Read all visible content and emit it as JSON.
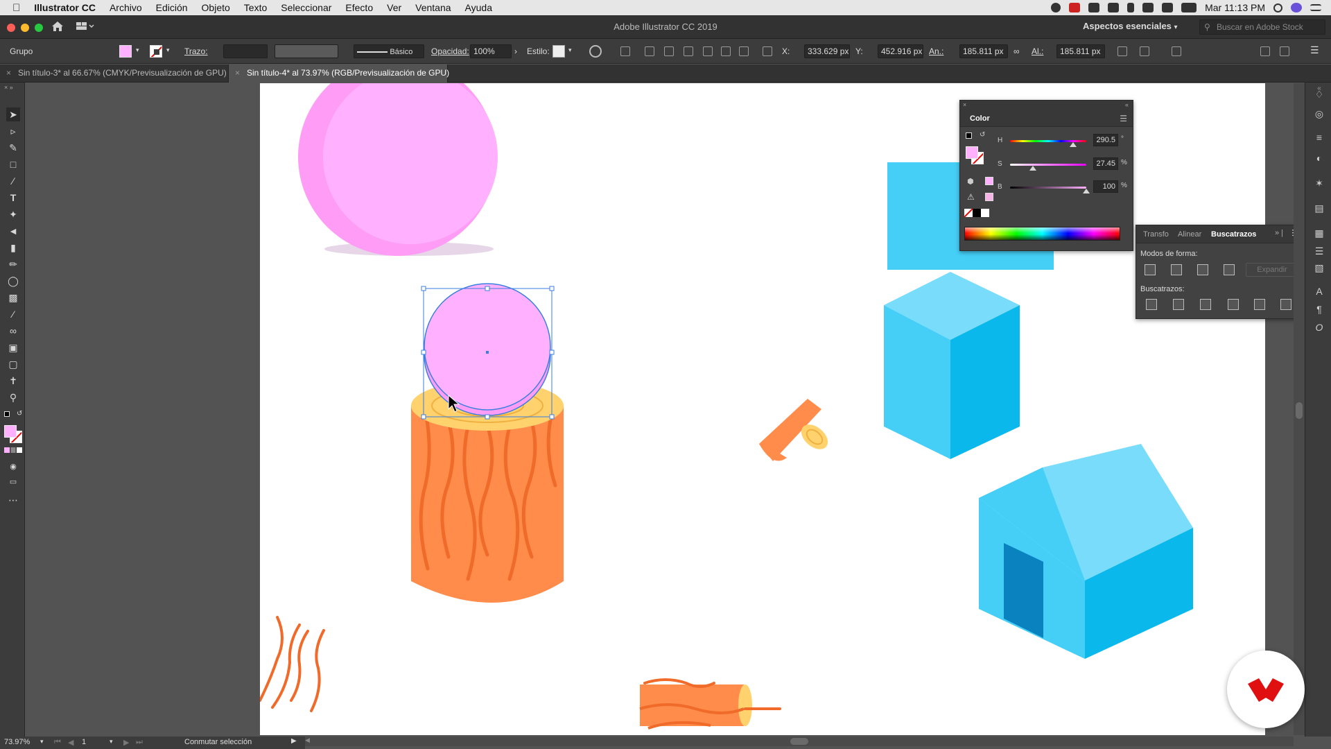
{
  "menubar": {
    "app_name": "Illustrator CC",
    "items": [
      "Archivo",
      "Edición",
      "Objeto",
      "Texto",
      "Seleccionar",
      "Efecto",
      "Ver",
      "Ventana",
      "Ayuda"
    ],
    "clock": "Mar 11:13 PM"
  },
  "window": {
    "title": "Adobe Illustrator CC 2019",
    "workspace": "Aspectos esenciales",
    "stock_placeholder": "Buscar en Adobe Stock"
  },
  "controlbar": {
    "selection_label": "Grupo",
    "stroke_label": "Trazo:",
    "brush_label": "Básico",
    "opacity_label": "Opacidad:",
    "opacity_value": "100%",
    "style_label": "Estilo:",
    "x_label": "X:",
    "x_value": "333.629 px",
    "y_label": "Y:",
    "y_value": "452.916 px",
    "w_label": "An.:",
    "w_value": "185.811 px",
    "h_label": "Al.:",
    "h_value": "185.811 px"
  },
  "tabs": [
    {
      "label": "Sin título-3* al 66.67% (CMYK/Previsualización de GPU)",
      "active": false
    },
    {
      "label": "Sin título-4* al 73.97% (RGB/Previsualización de GPU)",
      "active": true
    }
  ],
  "color_panel": {
    "title": "Color",
    "h_label": "H",
    "h_value": "290.5",
    "h_unit": "°",
    "s_label": "S",
    "s_value": "27.45",
    "s_unit": "%",
    "b_label": "B",
    "b_value": "100",
    "b_unit": "%",
    "fill_color": "#ffb1ff"
  },
  "pathfinder_panel": {
    "tabs": [
      "Transfo",
      "Alinear",
      "Buscatrazos"
    ],
    "active_tab": "Buscatrazos",
    "shape_modes_label": "Modos de forma:",
    "expand_label": "Expandir",
    "pathfinders_label": "Buscatrazos:"
  },
  "statusbar": {
    "zoom": "73.97%",
    "artboard_num": "1",
    "status_text": "Conmutar selección"
  },
  "colors": {
    "pink": "#ffb1ff",
    "pink_dark": "#ff9cf6",
    "orange": "#ff8c4a",
    "orange_line": "#f06a2a",
    "wood_top": "#ffd26e",
    "cyan": "#45cff7",
    "cyan_light": "#7adcfb",
    "cyan_dark": "#0ab8eb",
    "door": "#0a82c0",
    "selection": "#3a7fe0",
    "logo_red": "#e01010"
  }
}
